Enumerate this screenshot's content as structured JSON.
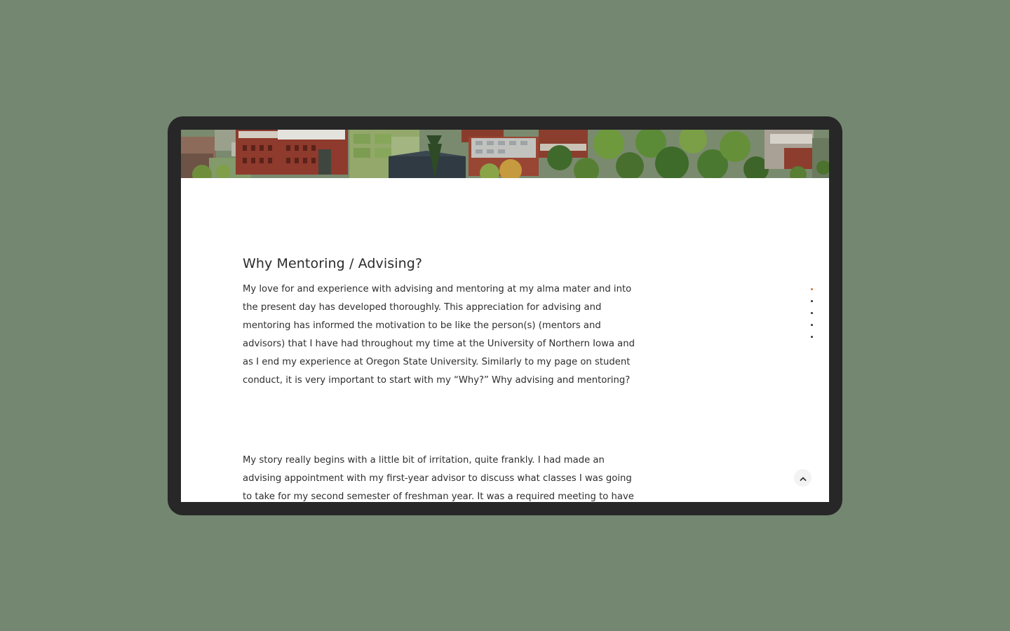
{
  "article": {
    "heading": "Why Mentoring / Advising?",
    "paragraph_1": "My love for and experience with advising and mentoring at my alma mater and into the present day has developed thoroughly. This appreciation for advising and mentoring has informed the motivation to be like the person(s) (mentors and advisors) that I have had throughout my time at the University of Northern Iowa and as I end my experience at Oregon State University. Similarly to my page on student conduct, it is very important to start with my “Why?” Why advising and mentoring?",
    "paragraph_2": "My story really begins with a little bit of irritation, quite frankly. I had made an advising appointment with my first-year advisor to discuss what classes I was going to take for my second semester of freshman year. It was a required meeting to have my hold lifted to"
  },
  "section_nav": {
    "count": 5,
    "active_index": 0,
    "active_color": "#d7732a",
    "inactive_color": "#333333"
  },
  "icons": {
    "back_to_top": "chevron-up-icon"
  },
  "colors": {
    "background": "#748771",
    "device_frame": "#272727",
    "screen": "#ffffff"
  }
}
